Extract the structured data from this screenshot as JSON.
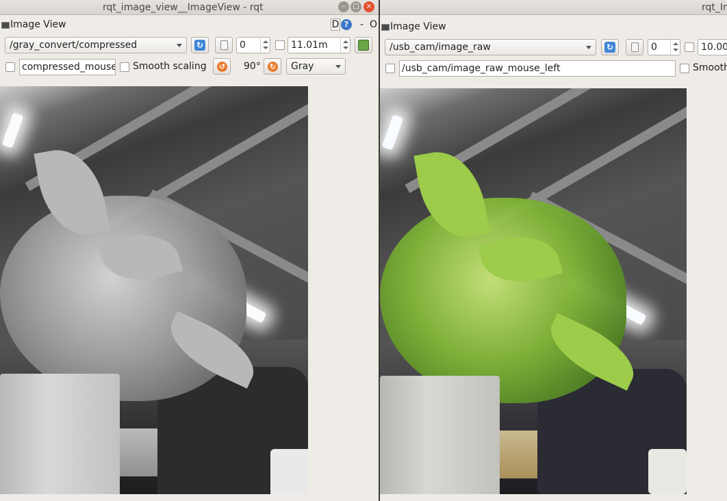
{
  "left_window": {
    "title": "rqt_image_view__ImageView - rqt",
    "plugin_title": "Image View",
    "plugin_d": "D",
    "plugin_help": "?",
    "plugin_dash": "-",
    "plugin_o": "O",
    "topic": "/gray_convert/compressed",
    "pause_value": "0",
    "timeout": "11.01m",
    "mouse_topic": "compressed_mouse_",
    "smooth_label": "Smooth scaling",
    "rotation": "90°",
    "color_scheme": "Gray",
    "image_mode": "grayscale"
  },
  "right_window": {
    "title": "rqt_Im",
    "plugin_title": "Image View",
    "topic": "/usb_cam/image_raw",
    "pause_value": "0",
    "timeout": "10.00",
    "mouse_topic": "/usb_cam/image_raw_mouse_left",
    "smooth_label": "Smooth",
    "image_mode": "color"
  },
  "window_buttons": {
    "minimize": "–",
    "maximize": "□",
    "close": "×"
  },
  "icons": {
    "refresh": "↻",
    "rotate_left": "↺",
    "rotate_right": "↻"
  },
  "colors": {
    "window_bg": "#efebe7",
    "close_button": "#e5532d",
    "refresh_blue": "#3f86d6",
    "rotate_orange": "#ea7a2b"
  }
}
